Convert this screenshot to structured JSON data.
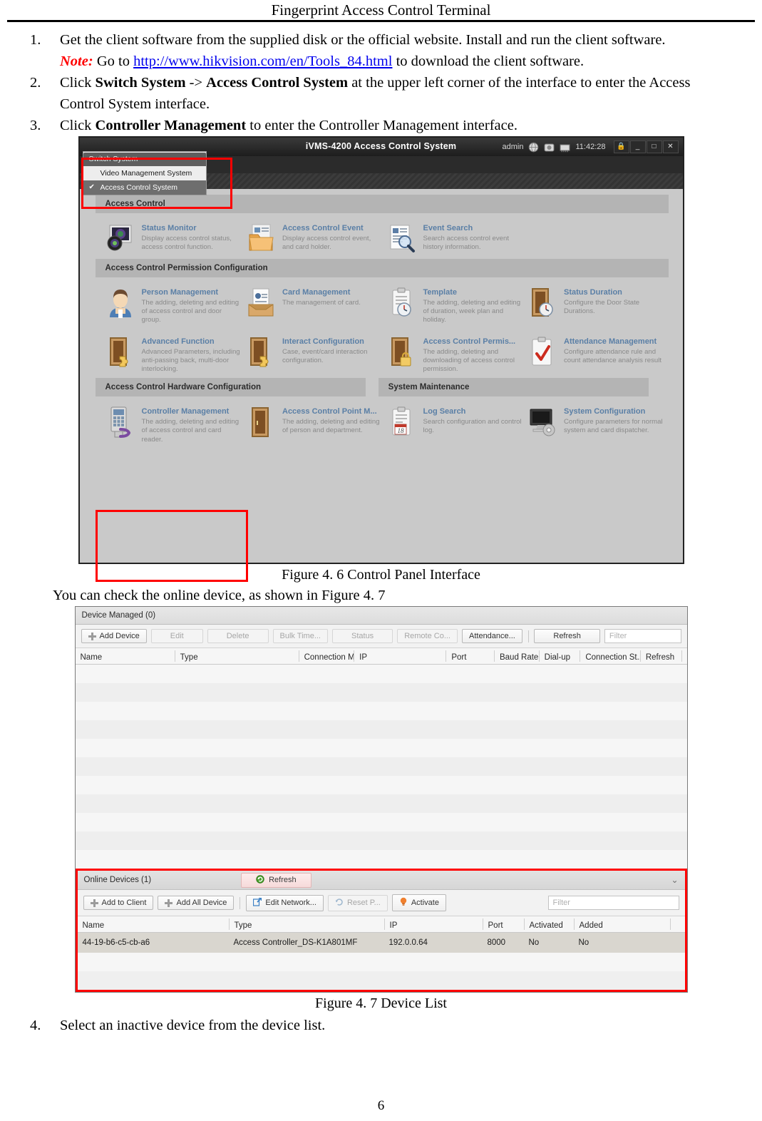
{
  "document": {
    "header_title": "Fingerprint Access Control Terminal",
    "page_number": "6"
  },
  "steps": [
    {
      "num": "1.",
      "text_a": "Get the client software from the supplied disk or the official website. Install and run the client software.",
      "note_label": "Note:",
      "note_pre": " Go to ",
      "link": "http://www.hikvision.com/en/Tools_84.html",
      "note_post": " to download the client software."
    },
    {
      "num": "2.",
      "pre": "Click ",
      "bold1": "Switch System",
      "mid": " -> ",
      "bold2": "Access Control System",
      "post": " at the upper left corner of the interface to enter the Access Control System interface."
    },
    {
      "num": "3.",
      "pre": "Click ",
      "bold1": "Controller Management",
      "post": " to enter the Controller Management interface."
    },
    {
      "num": "4.",
      "text_a": "Select an inactive device from the device list."
    }
  ],
  "figure_46": {
    "caption": "Figure 4. 6 Control Panel Interface",
    "titlebar": {
      "app_title": "iVMS-4200  Access Control System",
      "user": "admin",
      "icons": [
        "globe-icon",
        "camera-icon",
        "ram-icon"
      ],
      "time": "11:42:28",
      "window_buttons": [
        "lock-icon",
        "minimize-icon",
        "maximize-icon",
        "close-icon"
      ]
    },
    "menu": {
      "switch_system_label": "Switch System",
      "items": [
        {
          "label": "Video Management System",
          "checked": false
        },
        {
          "label": "Access Control System",
          "checked": true,
          "check_glyph": "✔"
        }
      ]
    },
    "sections": [
      {
        "title": "Access Control",
        "tiles": [
          {
            "icon": "status-monitor-icon",
            "title": "Status Monitor",
            "desc": "Display access control status, access control function."
          },
          {
            "icon": "folder-event-icon",
            "title": "Access Control Event",
            "desc": "Display access control event, and card holder."
          },
          {
            "icon": "event-search-icon",
            "title": "Event Search",
            "desc": "Search access control event history information."
          },
          {
            "icon": "",
            "title": "",
            "desc": ""
          }
        ]
      },
      {
        "title": "Access Control Permission Configuration",
        "tiles": [
          {
            "icon": "person-icon",
            "title": "Person Management",
            "desc": "The adding, deleting and editing of access control and door group."
          },
          {
            "icon": "card-box-icon",
            "title": "Card Management",
            "desc": "The management of card."
          },
          {
            "icon": "clipboard-clock-icon",
            "title": "Template",
            "desc": "The adding, deleting and editing of duration, week plan and holiday."
          },
          {
            "icon": "door-clock-icon",
            "title": "Status Duration",
            "desc": "Configure the Door State Durations."
          }
        ],
        "tiles2": [
          {
            "icon": "door-puzzle-icon",
            "title": "Advanced Function",
            "desc": "Advanced Parameters, including anti-passing back, multi-door interlocking."
          },
          {
            "icon": "door-puzzle-icon",
            "title": "Interact Configuration",
            "desc": "Case, event/card interaction configuration."
          },
          {
            "icon": "door-lock-icon",
            "title": "Access Control Permis...",
            "desc": "The adding, deleting and downloading of access control permission."
          },
          {
            "icon": "clipboard-check-icon",
            "title": "Attendance Management",
            "desc": "Configure attendance rule and count attendance analysis result"
          }
        ]
      },
      {
        "title": "Access Control Hardware Configuration",
        "title2": "System Maintenance",
        "tiles": [
          {
            "icon": "controller-icon",
            "title": "Controller Management",
            "desc": "The adding, deleting and editing of access control and card reader."
          },
          {
            "icon": "door-icon",
            "title": "Access Control Point M...",
            "desc": "The adding, deleting and editing of person and department."
          },
          {
            "icon": "log-search-icon",
            "title": "Log Search",
            "desc": "Search configuration and control log."
          },
          {
            "icon": "system-config-icon",
            "title": "System Configuration",
            "desc": "Configure parameters for normal system and card dispatcher."
          }
        ]
      }
    ]
  },
  "intro_fig47": "You can check the online device, as shown in Figure 4. 7",
  "figure_47": {
    "caption": "Figure 4. 7 Device List",
    "managed": {
      "header": "Device Managed (0)",
      "buttons": [
        {
          "label": "Add Device",
          "icon": "plus-icon",
          "disabled": false
        },
        {
          "label": "Edit",
          "disabled": true
        },
        {
          "label": "Delete",
          "disabled": true
        },
        {
          "label": "Bulk Time...",
          "disabled": true
        },
        {
          "label": "Status",
          "disabled": true
        },
        {
          "label": "Remote Co...",
          "disabled": true
        },
        {
          "label": "Attendance...",
          "disabled": false
        },
        {
          "label": "Refresh",
          "disabled": false
        }
      ],
      "filter_placeholder": "Filter",
      "columns": [
        "Name",
        "Type",
        "Connection M...",
        "IP",
        "Port",
        "Baud Rate",
        "Dial-up",
        "Connection St...",
        "Refresh"
      ],
      "rows": []
    },
    "online": {
      "header": "Online Devices (1)",
      "refresh_label": "Refresh",
      "refresh_icon": "refresh-green-icon",
      "collapse_icon": "chevron-down-icon",
      "buttons": [
        {
          "label": "Add to Client",
          "icon": "plus-icon",
          "disabled": false
        },
        {
          "label": "Add All Device",
          "icon": "plus-icon",
          "disabled": false
        },
        {
          "label": "Edit Network...",
          "icon": "edit-network-icon",
          "disabled": false
        },
        {
          "label": "Reset P...",
          "icon": "reset-arrow-icon",
          "disabled": true
        },
        {
          "label": "Activate",
          "icon": "activate-bulb-icon",
          "disabled": false
        }
      ],
      "filter_placeholder": "Filter",
      "columns": [
        "Name",
        "Type",
        "IP",
        "Port",
        "Activated",
        "Added"
      ],
      "rows": [
        {
          "name": "44-19-b6-c5-cb-a6",
          "type": "Access Controller_DS-K1A801MF",
          "ip": "192.0.0.64",
          "port": "8000",
          "activated": "No",
          "added": "No"
        }
      ]
    }
  },
  "colors": {
    "link": "#0000ee",
    "note_red": "#ff0000",
    "highlight_red": "#ff0000",
    "tile_title": "#5a7fa6",
    "activate_orange": "#f08030"
  }
}
